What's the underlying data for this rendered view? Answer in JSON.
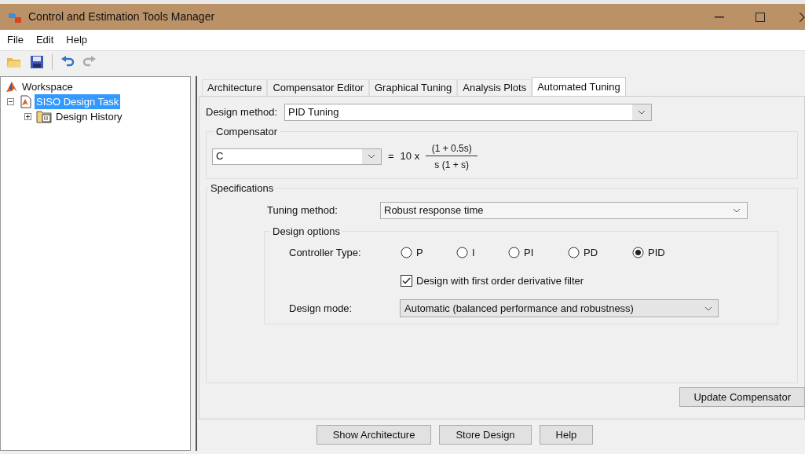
{
  "window": {
    "title": "Control and Estimation Tools Manager"
  },
  "menu": [
    "File",
    "Edit",
    "Help"
  ],
  "tree": [
    {
      "label": "Workspace",
      "selected": false,
      "children": [
        {
          "label": "SISO Design Task",
          "selected": true,
          "expanded": true,
          "children": [
            {
              "label": "Design History",
              "selected": false,
              "expanded": false
            }
          ]
        }
      ]
    }
  ],
  "tabs": [
    {
      "label": "Architecture",
      "selected": false
    },
    {
      "label": "Compensator Editor",
      "selected": false
    },
    {
      "label": "Graphical Tuning",
      "selected": false
    },
    {
      "label": "Analysis Plots",
      "selected": false
    },
    {
      "label": "Automated Tuning",
      "selected": true
    }
  ],
  "design_method": {
    "label": "Design method:",
    "value": "PID Tuning"
  },
  "compensator": {
    "title": "Compensator",
    "value": "C",
    "equals": "=",
    "gain": "10 x",
    "numerator": "(1 + 0.5s)",
    "denominator": "s (1 + s)"
  },
  "specifications": {
    "title": "Specifications",
    "tuning_method": {
      "label": "Tuning method:",
      "value": "Robust response time"
    },
    "design_options": {
      "title": "Design options",
      "controller_type_label": "Controller Type:",
      "controller_types": [
        {
          "label": "P",
          "selected": false
        },
        {
          "label": "I",
          "selected": false
        },
        {
          "label": "PI",
          "selected": false
        },
        {
          "label": "PD",
          "selected": false
        },
        {
          "label": "PID",
          "selected": true
        }
      ],
      "derivative_filter": {
        "label": "Design with first order derivative filter",
        "checked": true
      },
      "design_mode": {
        "label": "Design mode:",
        "value": "Automatic (balanced performance and robustness)"
      }
    }
  },
  "update_button": "Update Compensator",
  "buttons": [
    "Show Architecture",
    "Store Design",
    "Help"
  ]
}
